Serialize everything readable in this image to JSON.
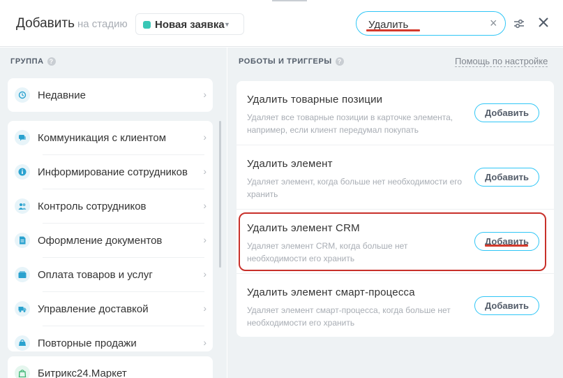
{
  "header": {
    "title": "Добавить",
    "stage_label": "на стадию",
    "stage_value": "Новая заявка",
    "stage_color": "#39c7b6",
    "search_value": "Удалить",
    "icons": [
      "settings-sliders-icon",
      "close-icon",
      "clear-icon"
    ]
  },
  "left": {
    "section_label": "ГРУППА",
    "recent": {
      "label": "Недавние",
      "icon": "history-icon"
    },
    "groups": [
      {
        "label": "Коммуникация с клиентом",
        "icon": "chat-icon"
      },
      {
        "label": "Информирование сотрудников",
        "icon": "info-icon"
      },
      {
        "label": "Контроль сотрудников",
        "icon": "users-icon"
      },
      {
        "label": "Оформление документов",
        "icon": "document-icon"
      },
      {
        "label": "Оплата товаров и услуг",
        "icon": "wallet-icon"
      },
      {
        "label": "Управление доставкой",
        "icon": "truck-icon"
      },
      {
        "label": "Повторные продажи",
        "icon": "repeat-sales-icon"
      }
    ],
    "market": {
      "label": "Битрикс24.Маркет",
      "icon": "market-bag-icon"
    }
  },
  "right": {
    "section_label": "РОБОТЫ И ТРИГГЕРЫ",
    "help_link": "Помощь по настройке",
    "robots": [
      {
        "title": "Удалить товарные позиции",
        "desc": "Удаляет все товарные позиции в карточке элемента, например, если клиент передумал покупать",
        "button": "Добавить"
      },
      {
        "title": "Удалить элемент",
        "desc": "Удаляет элемент, когда больше нет необходимости его хранить",
        "button": "Добавить"
      },
      {
        "title": "Удалить элемент CRM",
        "desc": "Удаляет элемент CRM, когда больше нет необходимости его хранить",
        "button": "Добавить"
      },
      {
        "title": "Удалить элемент смарт-процесса",
        "desc": "Удаляет элемент смарт-процесса, когда больше нет необходимости его хранить",
        "button": "Добавить"
      }
    ]
  },
  "colors": {
    "accent": "#2fc6f6",
    "annotation": "#d43a2c",
    "panel_bg": "#eef2f4"
  }
}
